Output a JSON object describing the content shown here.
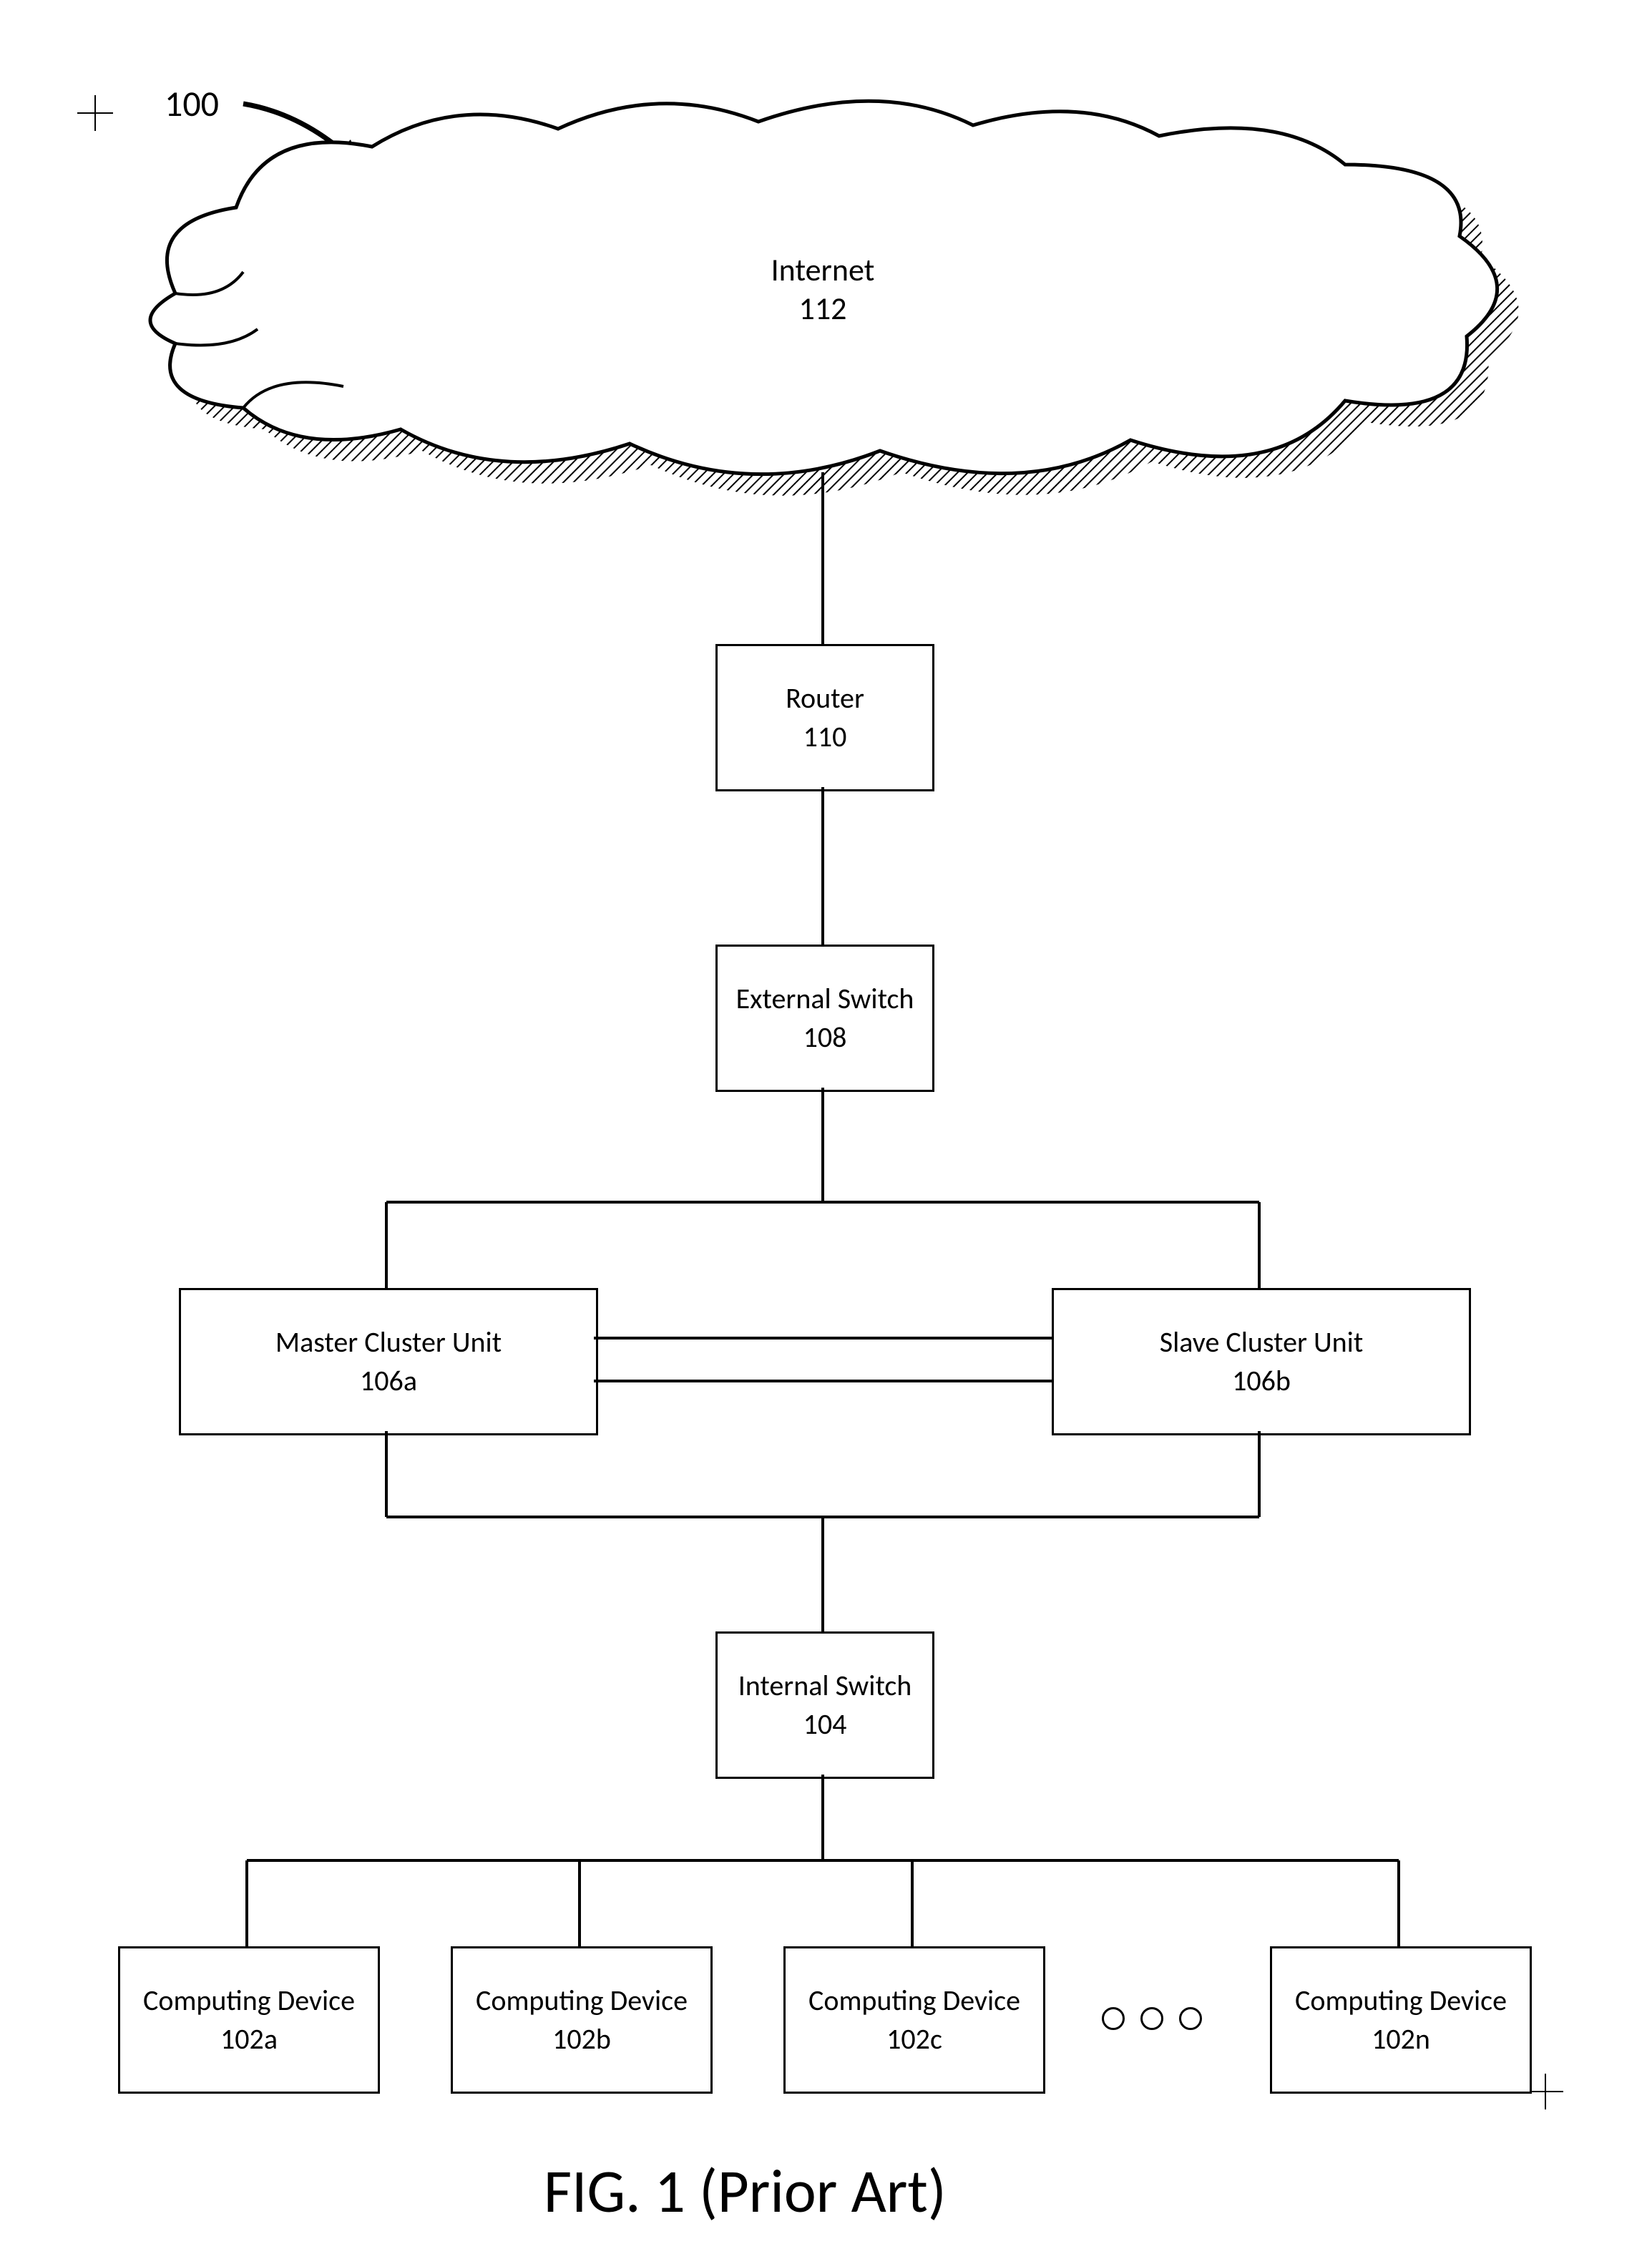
{
  "figure_ref": "100",
  "caption": "FIG. 1 (Prior Art)",
  "cloud": {
    "label": "Internet",
    "ref": "112"
  },
  "router": {
    "label": "Router",
    "ref": "110"
  },
  "ext_switch": {
    "label": "External Switch",
    "ref": "108"
  },
  "master": {
    "label": "Master Cluster Unit",
    "ref": "106a"
  },
  "slave": {
    "label": "Slave Cluster Unit",
    "ref": "106b"
  },
  "int_switch": {
    "label": "Internal Switch",
    "ref": "104"
  },
  "dev_a": {
    "label": "Computing Device",
    "ref": "102a"
  },
  "dev_b": {
    "label": "Computing Device",
    "ref": "102b"
  },
  "dev_c": {
    "label": "Computing Device",
    "ref": "102c"
  },
  "dev_n": {
    "label": "Computing Device",
    "ref": "102n"
  }
}
